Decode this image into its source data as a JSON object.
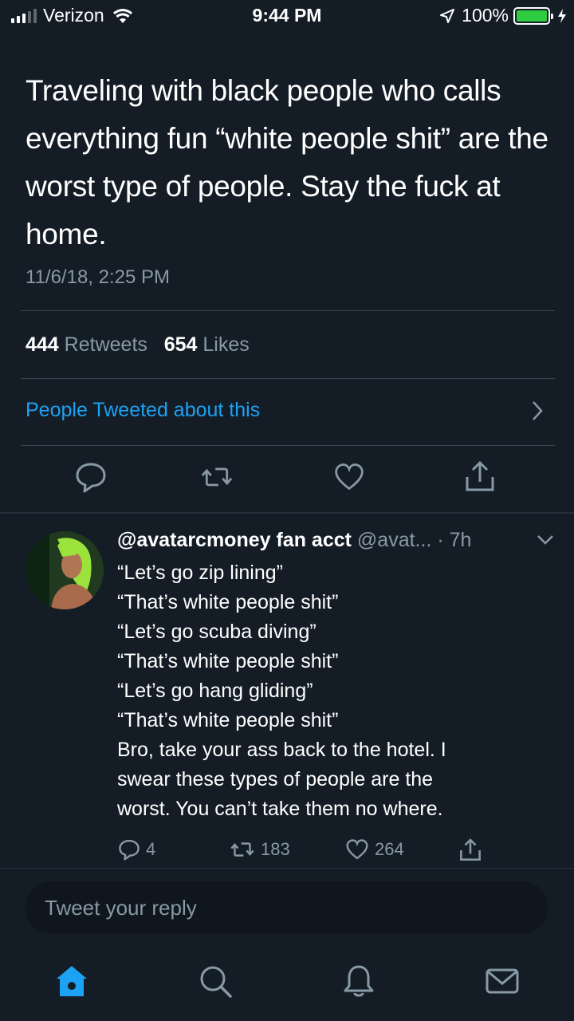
{
  "status_bar": {
    "carrier": "Verizon",
    "time": "9:44 PM",
    "battery": "100%",
    "battery_color": "#2ecc40"
  },
  "tweet": {
    "text": "Traveling with black people who calls everything fun “white people shit” are the worst type of people. Stay the fuck at home.",
    "date": "11/6/18, 2:25 PM",
    "retweets_count": "444",
    "retweets_label": "Retweets",
    "likes_count": "654",
    "likes_label": "Likes",
    "people_tweeted": "People Tweeted about this",
    "actions": [
      "reply-icon",
      "retweet-icon",
      "heart-icon",
      "share-icon"
    ]
  },
  "reply": {
    "name": "@avatarcmoney fan acct",
    "handle": "@avat...",
    "time": "· 7h",
    "lines": [
      "“Let’s go zip lining”",
      "“That’s white people shit”",
      "“Let’s go scuba diving”",
      "“That’s white people shit”",
      "“Let’s go hang gliding”",
      "“That’s white people shit”",
      "Bro, take your ass back to the hotel. I",
      "swear these types of people are the",
      "worst. You can’t take them no where."
    ],
    "reply_count": "4",
    "retweet_count": "183",
    "like_count": "264"
  },
  "composer": {
    "placeholder": "Tweet your reply"
  },
  "tab_bar": {
    "items": [
      "home-icon",
      "search-icon",
      "notifications-icon",
      "messages-icon"
    ],
    "active_color": "#1da1f2"
  }
}
